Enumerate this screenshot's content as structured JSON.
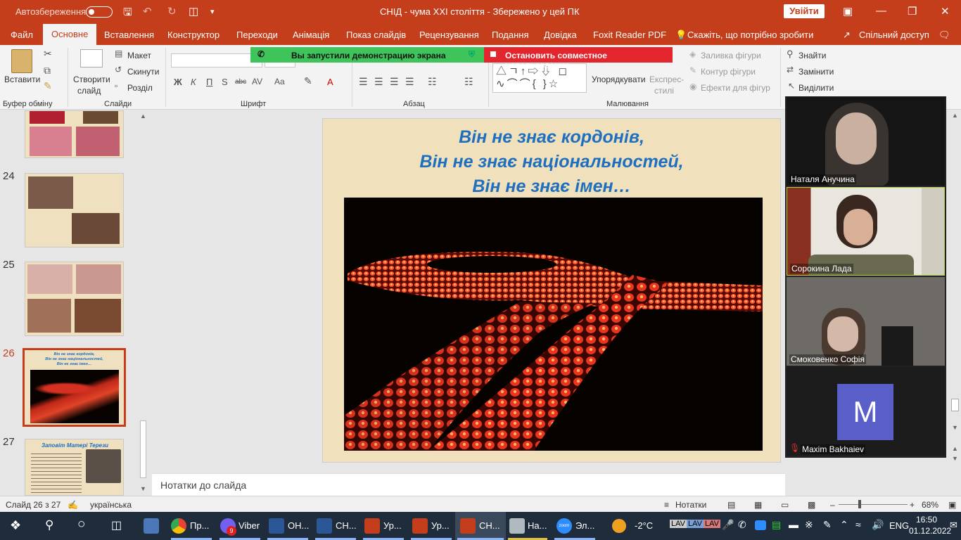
{
  "titlebar": {
    "autosave": "Автозбереження",
    "title": "СНІД - чума XXI століття  -  Збережено у цей ПК",
    "signin": "Увійти"
  },
  "tabs": [
    "Файл",
    "Основне",
    "Вставлення",
    "Конструктор",
    "Переходи",
    "Анімація",
    "Показ слайдів",
    "Рецензування",
    "Подання",
    "Довідка",
    "Foxit Reader PDF",
    "Скажіть, що потрібно зробити",
    "Спільний доступ"
  ],
  "ribbon": {
    "paste": "Вставити",
    "create_slide": "Створити",
    "slide_word": "слайд",
    "layout": "Макет",
    "reset": "Скинути",
    "section": "Розділ",
    "arrange": "Упорядкувати",
    "quick_styles_1": "Експрес-",
    "quick_styles_2": "стилі",
    "fill": "Заливка фігури",
    "outline": "Контур фігури",
    "effects": "Ефекти для фігур",
    "find": "Знайти",
    "replace": "Замінити",
    "select": "Виділити",
    "groups": {
      "clipboard": "Буфер обміну",
      "slides": "Слайди",
      "font": "Шрифт",
      "paragraph": "Абзац",
      "drawing": "Малювання"
    }
  },
  "share": {
    "running": "Вы запустили демонстрацию экрана",
    "stop": "Остановить совместное использование"
  },
  "thumbs": [
    {
      "n": "24"
    },
    {
      "n": "25"
    },
    {
      "n": "26",
      "l1": "Він не знає кордонів,",
      "l2": "Він не знає національностей,",
      "l3": "Він не знає імен…"
    },
    {
      "n": "27",
      "title": "Заповіт Матері Терези"
    }
  ],
  "slide": {
    "line1": "Він не знає кордонів,",
    "line2": "Він не знає національностей,",
    "line3": "Він не знає імен…"
  },
  "notes": "Нотатки до слайда",
  "participants": [
    {
      "name": "Наталя Анучина"
    },
    {
      "name": "Сорокина Лада"
    },
    {
      "name": "Смоковенко Софія"
    },
    {
      "name": "Maxim Bakhaiev",
      "initial": "M"
    }
  ],
  "status": {
    "slide": "Слайд 26 з 27",
    "lang": "українська",
    "notes": "Нотатки",
    "zoom": "68%"
  },
  "taskbar": {
    "items": [
      "Пр...",
      "Viber",
      "ОН...",
      "СН...",
      "Ур...",
      "Ур...",
      "СН...",
      "На...",
      "Эл..."
    ],
    "viber_badge": "9",
    "zoom_app": "zoom",
    "temp": "-2°C",
    "lang": "ENG",
    "time": "16:50",
    "date": "01.12.2022"
  },
  "colors": {
    "accent": "#c43e1c",
    "title_blue": "#1f6fc0",
    "share_green": "#3ec45a",
    "share_red": "#e3262d"
  }
}
